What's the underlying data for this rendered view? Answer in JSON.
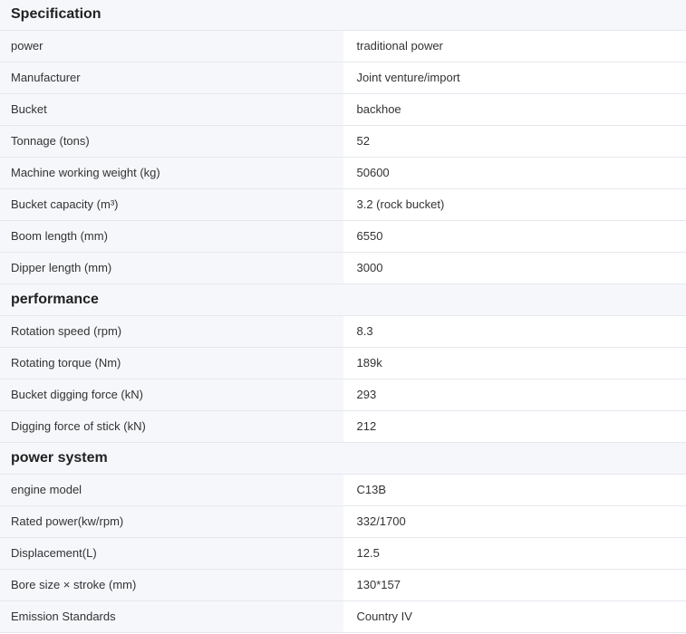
{
  "sections": [
    {
      "title": "Specification",
      "rows": [
        {
          "label": "power",
          "value": "traditional power"
        },
        {
          "label": "Manufacturer",
          "value": "Joint venture/import"
        },
        {
          "label": "Bucket",
          "value": "backhoe"
        },
        {
          "label": "Tonnage (tons)",
          "value": "52"
        },
        {
          "label": "Machine working weight (kg)",
          "value": "50600"
        },
        {
          "label": "Bucket capacity (m³)",
          "value": "3.2 (rock bucket)"
        },
        {
          "label": "Boom length (mm)",
          "value": "6550"
        },
        {
          "label": "Dipper length (mm)",
          "value": "3000"
        }
      ]
    },
    {
      "title": "performance",
      "rows": [
        {
          "label": "Rotation speed (rpm)",
          "value": "8.3"
        },
        {
          "label": "Rotating torque (Nm)",
          "value": "189k"
        },
        {
          "label": "Bucket digging force (kN)",
          "value": "293"
        },
        {
          "label": "Digging force of stick (kN)",
          "value": "212"
        }
      ]
    },
    {
      "title": "power system",
      "rows": [
        {
          "label": "engine model",
          "value": "C13B"
        },
        {
          "label": "Rated power(kw/rpm)",
          "value": "332/1700"
        },
        {
          "label": "Displacement(L)",
          "value": "12.5"
        },
        {
          "label": "Bore size × stroke (mm)",
          "value": "130*157"
        },
        {
          "label": "Emission Standards",
          "value": "Country IV"
        }
      ]
    }
  ]
}
